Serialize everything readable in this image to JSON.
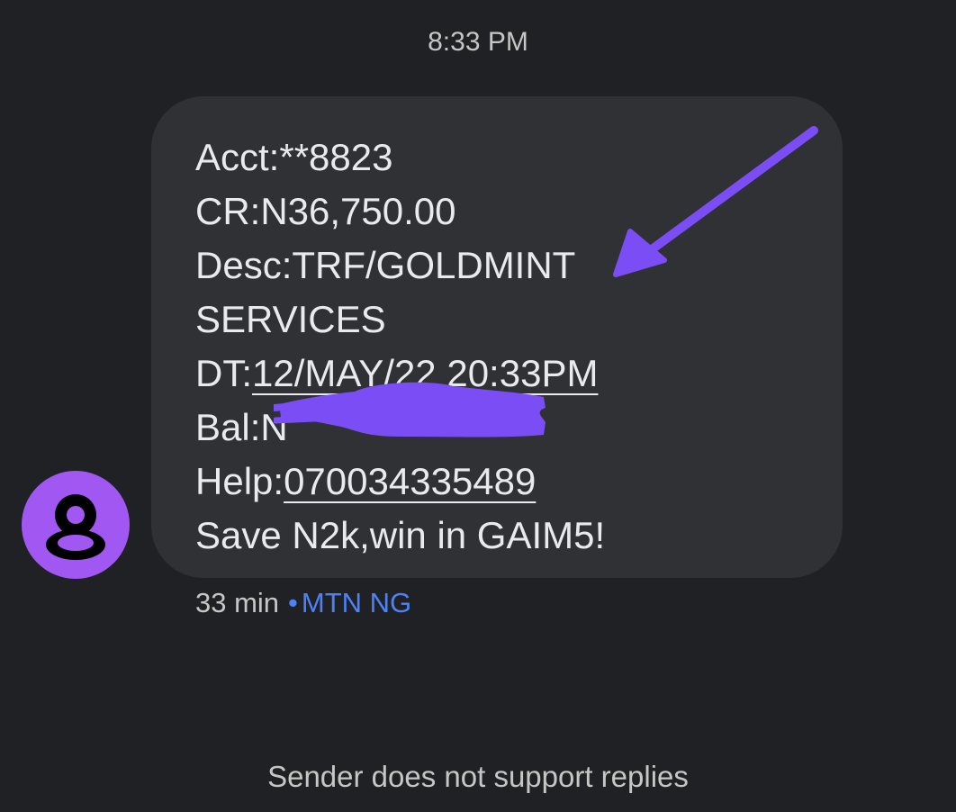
{
  "header": {
    "time": "8:33 PM"
  },
  "message": {
    "line_acct": "Acct:**8823",
    "line_cr": "CR:N36,750.00",
    "line_desc": "Desc:TRF/GOLDMINT",
    "line_desc_cont": "SERVICES",
    "dt_prefix": "DT:",
    "dt_value": "12/MAY/22 20:33PM",
    "bal_prefix": "Bal:N",
    "help_prefix": "Help:",
    "help_number": "07003433548‌9",
    "line_promo": "Save N2k,win in GAIM5!"
  },
  "meta": {
    "age": "33 min",
    "separator": "•",
    "sender": "MTN NG"
  },
  "footer": {
    "note": "Sender does not support replies"
  },
  "colors": {
    "background": "#202124",
    "bubble": "#303134",
    "avatar": "#a157f1",
    "annotation": "#7b4df5",
    "sender_link": "#4d82f6"
  },
  "icons": {
    "avatar": "person-icon",
    "annotation": "arrow-annotation-icon"
  }
}
